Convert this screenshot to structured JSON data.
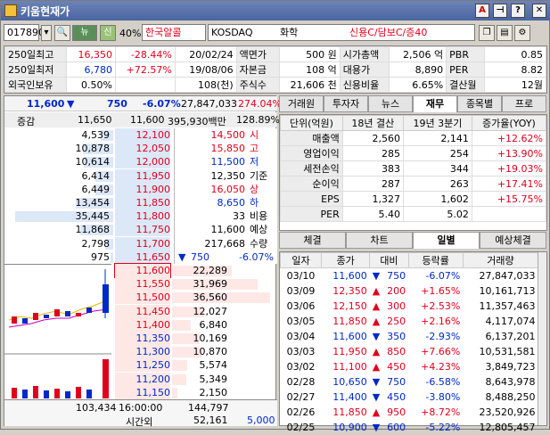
{
  "window": {
    "title": "키움현재가",
    "btn_a": "A",
    "btn_pin": "⊣",
    "btn_help": "?",
    "btn_close": "✕"
  },
  "toolbar": {
    "code": "017890",
    "chart_label": "뉴",
    "credit_label": "신",
    "margin": "40%",
    "name": "한국알콜",
    "market": "KOSDAQ",
    "sector": "화학",
    "flags": "신용C/담보C/증40"
  },
  "info": {
    "rows": [
      [
        "250일최고",
        "16,350",
        "-28.44%",
        "20/02/24",
        "액면가",
        "500 원",
        "시가총액",
        "2,506 억",
        "PBR",
        "0.85"
      ],
      [
        "250일최저",
        "6,780",
        "+72.57%",
        "19/08/06",
        "자본금",
        "108 억",
        "대용가",
        "8,890",
        "PER",
        "8.82"
      ],
      [
        "외국인보유",
        "0.50%",
        "",
        "108(천)",
        "주식수",
        "21,606 천",
        "신용비율",
        "6.65%",
        "결산월",
        "12월"
      ]
    ]
  },
  "price": {
    "current": "11,600",
    "change": "750",
    "rate": "-6.07%",
    "volume": "27,847,033",
    "vol_rate": "274.04%"
  },
  "orderbook": {
    "header": {
      "label": "증감",
      "ask_vol": "11,650",
      "price": "11,600",
      "amount": "395,930백만",
      "ratio": "128.89%"
    },
    "asks": [
      {
        "chg": "",
        "vol": "4,539",
        "price": "12,100"
      },
      {
        "chg": "",
        "vol": "10,878",
        "price": "12,050"
      },
      {
        "chg": "",
        "vol": "10,614",
        "price": "12,000"
      },
      {
        "chg": "",
        "vol": "6,414",
        "price": "11,950"
      },
      {
        "chg": "",
        "vol": "6,449",
        "price": "11,900"
      },
      {
        "chg": "",
        "vol": "13,454",
        "price": "11,850"
      },
      {
        "chg": "",
        "vol": "35,445",
        "price": "11,800"
      },
      {
        "chg": "",
        "vol": "11,868",
        "price": "11,750"
      },
      {
        "chg": "",
        "vol": "2,798",
        "price": "11,700"
      },
      {
        "chg": "",
        "vol": "975",
        "price": "11,650"
      }
    ],
    "bids": [
      {
        "price": "11,600",
        "vol": "22,289"
      },
      {
        "price": "11,550",
        "vol": "31,969"
      },
      {
        "price": "11,500",
        "vol": "36,560"
      },
      {
        "price": "11,450",
        "vol": "12,027"
      },
      {
        "price": "11,400",
        "vol": "6,840"
      },
      {
        "price": "11,350",
        "vol": "10,169"
      },
      {
        "price": "11,300",
        "vol": "10,870"
      },
      {
        "price": "11,250",
        "vol": "5,574"
      },
      {
        "price": "11,200",
        "vol": "5,349"
      },
      {
        "price": "11,150",
        "vol": "2,150"
      }
    ],
    "summary": [
      {
        "val": "14,500",
        "lbl": "시"
      },
      {
        "val": "15,850",
        "lbl": "고"
      },
      {
        "val": "11,500",
        "lbl": "저"
      },
      {
        "val": "12,350",
        "lbl": "기준"
      },
      {
        "val": "16,050",
        "lbl": "상"
      },
      {
        "val": "8,650",
        "lbl": "하"
      },
      {
        "val": "33",
        "lbl": "비용"
      },
      {
        "val": "11,600",
        "lbl": "예상"
      },
      {
        "val": "217,668",
        "lbl": "수량"
      }
    ],
    "exp_change": "750",
    "exp_rate": "-6.07%",
    "footer": {
      "ask_total": "103,434",
      "time": "16:00:00",
      "bid_total": "144,797",
      "after_label": "시간외",
      "after_ask": "",
      "after_bid": "52,161",
      "after_extra": "5,000"
    }
  },
  "right_tabs": [
    "거래원",
    "투자자",
    "뉴스",
    "재무",
    "종목별",
    "프로"
  ],
  "fin": {
    "headers": [
      "단위(억원)",
      "18년 결산",
      "19년 3분기",
      "증가율(YOY)"
    ],
    "rows": [
      [
        "매출액",
        "2,560",
        "2,141",
        "+12.62%"
      ],
      [
        "영업이익",
        "285",
        "254",
        "+13.90%"
      ],
      [
        "세전손익",
        "383",
        "344",
        "+19.03%"
      ],
      [
        "순이익",
        "287",
        "263",
        "+17.41%"
      ],
      [
        "EPS",
        "1,327",
        "1,602",
        "+15.75%"
      ],
      [
        "PER",
        "5.40",
        "5.02",
        ""
      ]
    ]
  },
  "daily_tabs": [
    "체결",
    "차트",
    "일별",
    "예상체결"
  ],
  "daily": {
    "headers": [
      "일자",
      "종가",
      "대비",
      "등락률",
      "거래량"
    ],
    "rows": [
      {
        "date": "03/10",
        "close": "11,600",
        "dir": "down",
        "chg": "750",
        "rate": "-6.07%",
        "vol": "27,847,033"
      },
      {
        "date": "03/09",
        "close": "12,350",
        "dir": "up",
        "chg": "200",
        "rate": "+1.65%",
        "vol": "10,161,713"
      },
      {
        "date": "03/06",
        "close": "12,150",
        "dir": "up",
        "chg": "300",
        "rate": "+2.53%",
        "vol": "11,357,463"
      },
      {
        "date": "03/05",
        "close": "11,850",
        "dir": "up",
        "chg": "250",
        "rate": "+2.16%",
        "vol": "4,117,074"
      },
      {
        "date": "03/04",
        "close": "11,600",
        "dir": "down",
        "chg": "350",
        "rate": "-2.93%",
        "vol": "6,137,201"
      },
      {
        "date": "03/03",
        "close": "11,950",
        "dir": "up",
        "chg": "850",
        "rate": "+7.66%",
        "vol": "10,531,581"
      },
      {
        "date": "03/02",
        "close": "11,100",
        "dir": "up",
        "chg": "450",
        "rate": "+4.23%",
        "vol": "3,849,723"
      },
      {
        "date": "02/28",
        "close": "10,650",
        "dir": "down",
        "chg": "750",
        "rate": "-6.58%",
        "vol": "8,643,978"
      },
      {
        "date": "02/27",
        "close": "11,400",
        "dir": "down",
        "chg": "450",
        "rate": "-3.80%",
        "vol": "8,488,250"
      },
      {
        "date": "02/26",
        "close": "11,850",
        "dir": "up",
        "chg": "950",
        "rate": "+8.72%",
        "vol": "23,520,926"
      },
      {
        "date": "02/25",
        "close": "10,900",
        "dir": "down",
        "chg": "600",
        "rate": "-5.22%",
        "vol": "12,805,457"
      }
    ]
  },
  "colors": {
    "up": "#e0001c",
    "down": "#0028c8",
    "ask_bg": "#dce8f8",
    "bid_bg": "#fde8e6",
    "title_bg": "#4a64a0"
  }
}
